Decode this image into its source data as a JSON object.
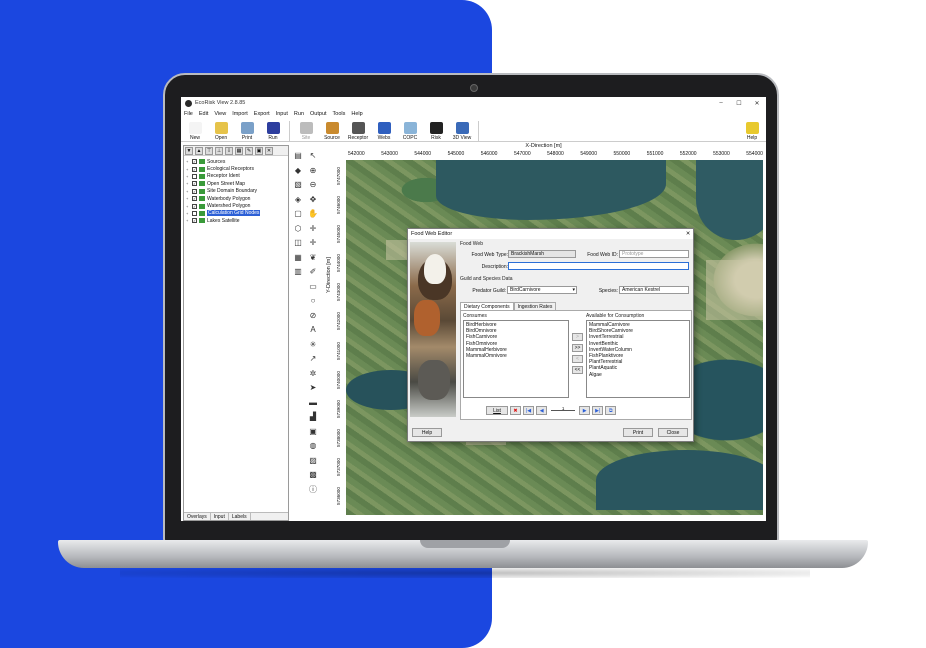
{
  "window": {
    "title": "EcoRisk View 2.8.85",
    "min": "–",
    "max": "☐",
    "close": "✕"
  },
  "menu": [
    "File",
    "Edit",
    "View",
    "Import",
    "Export",
    "Input",
    "Run",
    "Output",
    "Tools",
    "Help"
  ],
  "toolbar": [
    {
      "label": "New",
      "color": "#f4f4f4"
    },
    {
      "label": "Open",
      "color": "#e6c34a"
    },
    {
      "label": "Print",
      "color": "#7aa0c8"
    },
    {
      "label": "Run",
      "color": "#2d3e9e"
    },
    {
      "label": "Site",
      "color": "#bcbcbc"
    },
    {
      "label": "Source",
      "color": "#c98a2e"
    },
    {
      "label": "Receptor",
      "color": "#555555"
    },
    {
      "label": "Webs",
      "color": "#2f5fbf"
    },
    {
      "label": "COPC",
      "color": "#8ab4d8"
    },
    {
      "label": "Risk",
      "color": "#222222"
    },
    {
      "label": "3D View",
      "color": "#3a6ab8"
    },
    {
      "label": "Help",
      "color": "#e8c92e"
    }
  ],
  "tree": [
    {
      "label": "Sources",
      "checked": true
    },
    {
      "label": "Ecological Receptors",
      "checked": true
    },
    {
      "label": "Receptor Ident",
      "checked": false
    },
    {
      "label": "Open Street Map",
      "checked": true
    },
    {
      "label": "Site Domain Boundary",
      "checked": true
    },
    {
      "label": "Waterbody Polygon",
      "checked": true
    },
    {
      "label": "Watershed Polygon",
      "checked": true
    },
    {
      "label": "Calculation Grid Nodes",
      "checked": false,
      "selected": true
    },
    {
      "label": "Lakes Satellite",
      "checked": true
    }
  ],
  "left_tabs": [
    "Overlays",
    "Input",
    "Labels"
  ],
  "map": {
    "x_label": "X-Direction [m]",
    "y_label": "Y-Direction [m]",
    "x_ticks": [
      "542000",
      "543000",
      "544000",
      "545000",
      "546000",
      "547000",
      "548000",
      "549000",
      "550000",
      "551000",
      "552000",
      "553000",
      "554000"
    ],
    "y_ticks": [
      "5747000",
      "5746000",
      "5745000",
      "5744000",
      "5743000",
      "5742000",
      "5741000",
      "5740000",
      "5739000",
      "5738000",
      "5737000",
      "5736000"
    ]
  },
  "dialog": {
    "title": "Food Web Editor",
    "close": "✕",
    "food_web_group": "Food Web",
    "food_web_type_label": "Food Web Type:",
    "food_web_type": "BrackishMarsh",
    "food_web_id_label": "Food Web ID:",
    "food_web_id_placeholder": "Prototype",
    "description_label": "Description:",
    "description": "",
    "guild_group": "Guild and Species Data",
    "predator_guild_label": "Predator Guild:",
    "predator_guild": "BirdCarnivore",
    "species_label": "Species:",
    "species": "American Kestrel",
    "tabs": [
      "Dietary Components",
      "Ingestion Rates"
    ],
    "consumes_label": "Consumes",
    "consumes": [
      "BirdHerbivore",
      "BirdOmnivore",
      "FishCarnivore",
      "FishOmnivore",
      "MammalHerbivore",
      "MammalOmnivore"
    ],
    "available_label": "Available for Consumption",
    "available": [
      "MammalCarnivore",
      "BirdShoreCarnivore",
      "InvertTerrestrial",
      "InvertBenthic",
      "InvertWaterColumn",
      "FishPlanktivore",
      "PlantTerrestrial",
      "PlantAquatic",
      "Algae"
    ],
    "move_buttons": [
      ">",
      ">>",
      "<",
      "<<"
    ],
    "list_btn": "List",
    "delete_btn": "✖",
    "first_btn": "|◀",
    "prev_btn": "◀",
    "slider_value": "1",
    "next_btn": "▶",
    "last_btn": "▶|",
    "copy_btn": "⧉",
    "help_btn": "Help",
    "print_btn": "Print",
    "close_btn": "Close"
  }
}
